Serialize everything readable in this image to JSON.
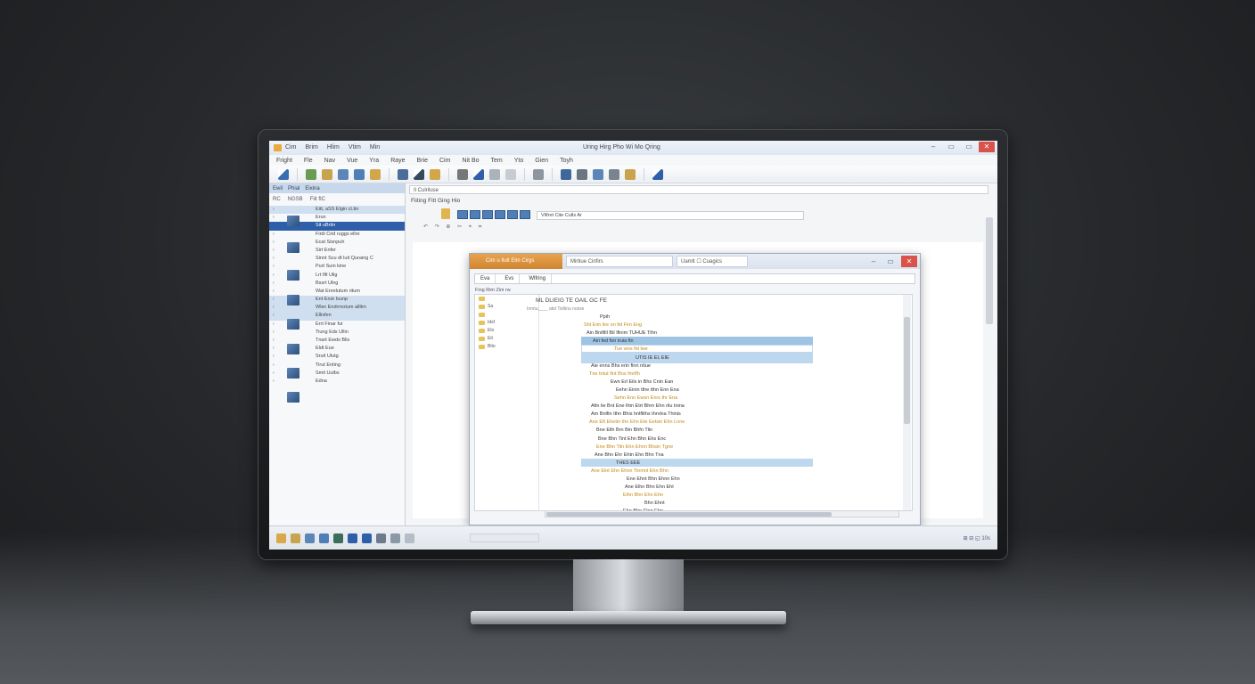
{
  "app": {
    "title_menu": [
      "Cim",
      "Brim",
      "Hlim",
      "Vtim",
      "Min"
    ],
    "window_title": "Uring Hirg Pho Wi Mo Qring",
    "win_buttons": {
      "minimize": "–",
      "maximize": "▭",
      "close": "✕"
    }
  },
  "menubar": [
    "Fright",
    "Fle",
    "Nav",
    "Vue",
    "Yra",
    "Raye",
    "Brie",
    "Cim",
    "Nit Bo",
    "Tem",
    "Yto",
    "Gien",
    "Toyh"
  ],
  "left_pane": {
    "header_tabs": [
      "Ewil",
      "Phial",
      "Eixina"
    ],
    "subheader": [
      "RC",
      "NGSB",
      "Fiit fIC"
    ],
    "rows": [
      {
        "label": "Eitt, aSS  Elgin cLtin",
        "state": "hl"
      },
      {
        "label": "Erun",
        "state": ""
      },
      {
        "label": "Sit uBrtin",
        "state": "sel"
      },
      {
        "label": "Firdi Crid ruggs ellre",
        "state": ""
      },
      {
        "label": "Ecat Sisnpuh",
        "state": ""
      },
      {
        "label": "Sirt Enfer",
        "state": ""
      },
      {
        "label": "Sinnt Scu dt luit Quraing C",
        "state": ""
      },
      {
        "label": "Purt Suin kine",
        "state": ""
      },
      {
        "label": "Lrt fifi Ulig",
        "state": ""
      },
      {
        "label": "Bssrt Ulng",
        "state": ""
      },
      {
        "label": "Wat Enrelutum ritum",
        "state": ""
      },
      {
        "label": "Ent Eruk Isunp",
        "state": "hl"
      },
      {
        "label": "Wlsn Endrrnotum allltm",
        "state": "hl"
      },
      {
        "label": "Ellisfen",
        "state": "hl"
      },
      {
        "label": "Errt Finar fur",
        "state": ""
      },
      {
        "label": "Tiung Eds Ullin",
        "state": ""
      },
      {
        "label": "Tnart Ewds Blis",
        "state": ""
      },
      {
        "label": "Eldt Eue",
        "state": ""
      },
      {
        "label": "Sruit Ulutg",
        "state": ""
      },
      {
        "label": "Tirut Enting",
        "state": ""
      },
      {
        "label": "Smit Uulbs",
        "state": ""
      },
      {
        "label": "Edna",
        "state": ""
      }
    ]
  },
  "main": {
    "breadcrumb": "Il Culriluse",
    "doc_title": "Fiiting Fitt Ging Hio",
    "address": "Vlifret Cite Culls Ar",
    "tools": "↶ ↷ ⊕ ✂ ⌖ ⌗"
  },
  "dialog": {
    "tab_active": "Cim u Ilult Elm Cirgs",
    "tab2": "Mirtiue Cinfirs",
    "tab3": "Uamlt  ☐ Cuagics",
    "bar": [
      "Eva",
      "Evs",
      "Wlfring"
    ],
    "sub": "Fing Rim Zini rw",
    "tree": [
      "",
      "Sa",
      "",
      "Idsf",
      "Elo",
      "Eit",
      "Bito"
    ],
    "header": "ML DLIEIG TE OAIL GC FE",
    "header2": "Inmtu____ atid Tsitlinu nosse",
    "lines": [
      "Ppih",
      "Sht Eim lire on fid Fim Eng",
      "Ain Bnilfill BiI lfinim TUHUE Tthn",
      "Airi fed fon iruia fin",
      "Tue wns fid lwe",
      "UTIS IE EL EIE",
      "Aie enns Bhs erin finn ntiue",
      "Tne tntut fint Bns fmrlfh",
      "Ewn Erl Eils in Bhs Cnin Ean",
      "Eehn Einin tthe tthn Enn Ena",
      "Sehn Enn Ewsn Enrs thr Ena",
      "Afin lie Bnt Ene lhtn Etrt Bhrn Ehn rilu tnina",
      "Am Bnlfin Ithn Bhis hnlfliths thrvlna Thinis",
      "Ane Eft Ehetin thn Ehn Ete Eetsin Ehn Lnne",
      "Bne Elih Brn Bin Bhfn Tlin",
      "Bne Bhn Tint Ehn Bhn Ehs Enc",
      "Ene Bhn Tiln Ehn Ehnn Bhsin Tgne",
      "Ane Bhn Ehr Ehtn Ehn Bhn Tna",
      "THES EEE",
      "Ane Elnt Ehn Ehnn Tinmnl Ehn Bhn",
      "Ene Ehnt Bhn Ehnn Ehn",
      "Ane Elhn Bhn Ehn Eht",
      "Eihn Bhn Ehn Ehn",
      "Bhn Ehnt",
      "Ehn Bhn Elnn Ehn"
    ]
  },
  "status": {
    "field": "",
    "right": "⊞ ⊟ ◱ 10s"
  },
  "colors": {
    "accent": "#2e5fa8",
    "tab_orange": "#d98a30",
    "highlight_band": "#bcd7ee",
    "text_orange": "#d89a1a",
    "close_red": "#d9534a"
  }
}
